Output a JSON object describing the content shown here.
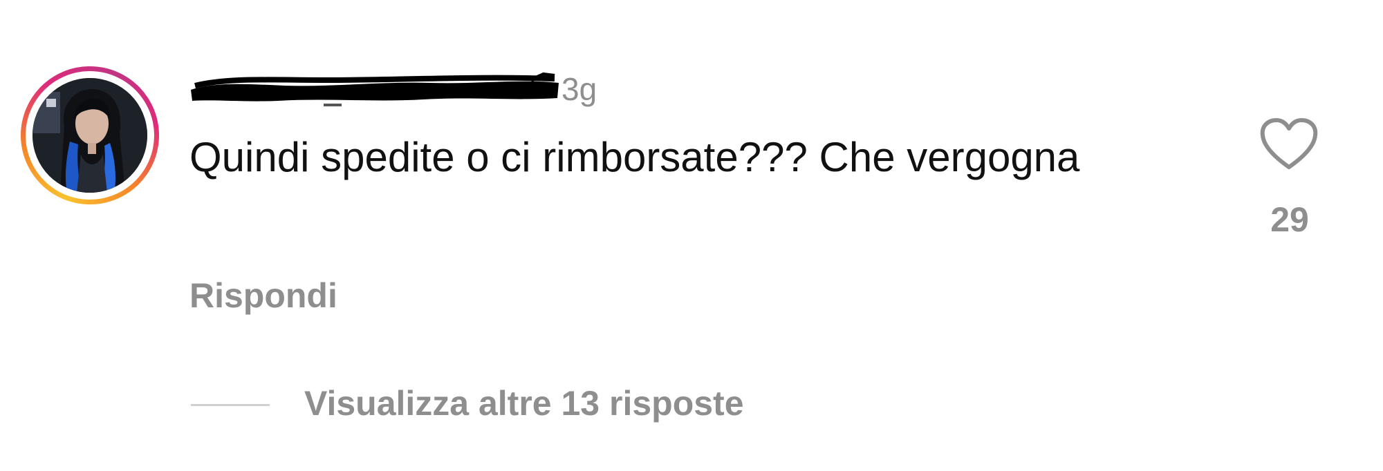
{
  "comment": {
    "author_avatar_icon": "avatar-icon",
    "username": "",
    "timestamp": "3g",
    "text": "Quindi spedite o ci rimborsate??? Che vergogna",
    "reply_label": "Rispondi",
    "like_icon": "heart-outline-icon",
    "like_count": "29",
    "view_replies_label": "Visualizza altre 13 risposte"
  },
  "colors": {
    "text_primary": "#111111",
    "text_secondary": "#8e8e8e",
    "story_ring_start": "#f9c22e",
    "story_ring_end": "#c13584",
    "background": "#ffffff"
  }
}
